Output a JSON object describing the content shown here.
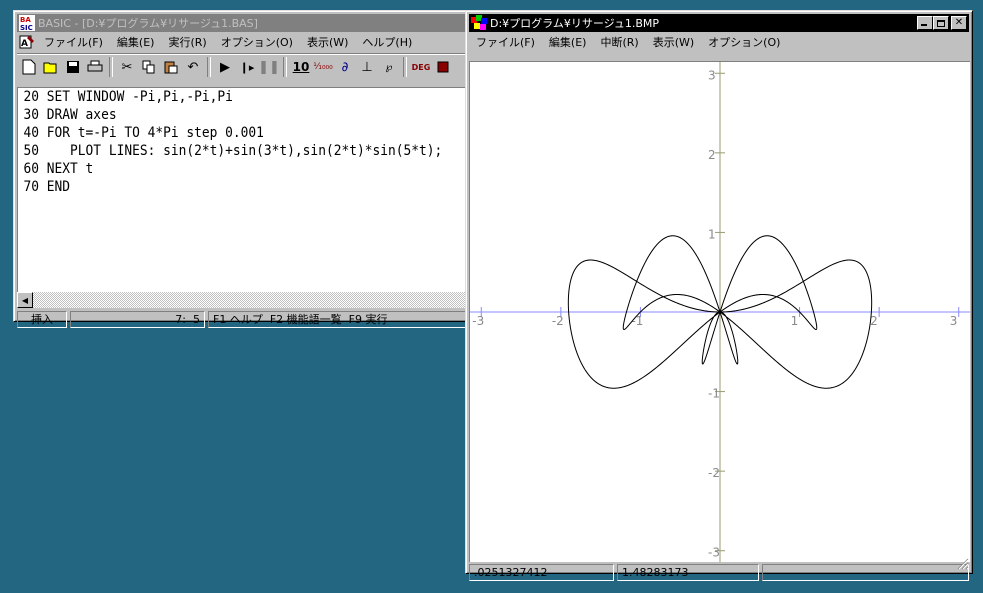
{
  "basic_window": {
    "title": "BASIC - [D:¥プログラム¥リサージュ1.BAS]",
    "menu": [
      "ファイル(F)",
      "編集(E)",
      "実行(R)",
      "オプション(O)",
      "表示(W)",
      "ヘルプ(H)"
    ],
    "toolbar": [
      "new-icon",
      "open-icon",
      "save-icon",
      "print-icon",
      "cut-icon",
      "copy-icon",
      "paste-icon",
      "undo-icon",
      "run-icon",
      "step-icon",
      "pause-icon",
      "decimal-icon",
      "thousand-icon",
      "format-icon",
      "rule-icon",
      "fig-icon",
      "deg-icon",
      "book-icon"
    ],
    "code": [
      "20 SET WINDOW -Pi,Pi,-Pi,Pi",
      "30 DRAW axes",
      "40 FOR t=-Pi TO 4*Pi step 0.001",
      "50    PLOT LINES: sin(2*t)+sin(3*t),sin(2*t)*sin(5*t);",
      "60 NEXT t",
      "70 END"
    ],
    "status": {
      "mode": "挿入",
      "position": "7:  5",
      "hints": "F1 ヘルプ  F2 機能語一覧  F9 実行"
    },
    "deg_label": "DEG",
    "num_label": "10"
  },
  "bmp_window": {
    "title": "D:¥プログラム¥リサージュ1.BMP",
    "menu": [
      "ファイル(F)",
      "編集(E)",
      "中断(R)",
      "表示(W)",
      "オプション(O)"
    ],
    "status": {
      "x": ".0251327412",
      "y": "1.48283173",
      "extra": ""
    },
    "plot": {
      "x_range": [
        -3.14159,
        3.14159
      ],
      "y_range": [
        -3.14159,
        3.14159
      ],
      "x_ticks": [
        "-3",
        "-2",
        "-1",
        "1",
        "2",
        "3"
      ],
      "y_ticks": [
        "3",
        "2",
        "1",
        "-1",
        "-2",
        "-3"
      ],
      "curve": "x=sin(2t)+sin(3t), y=sin(2t)*sin(5t)"
    }
  }
}
